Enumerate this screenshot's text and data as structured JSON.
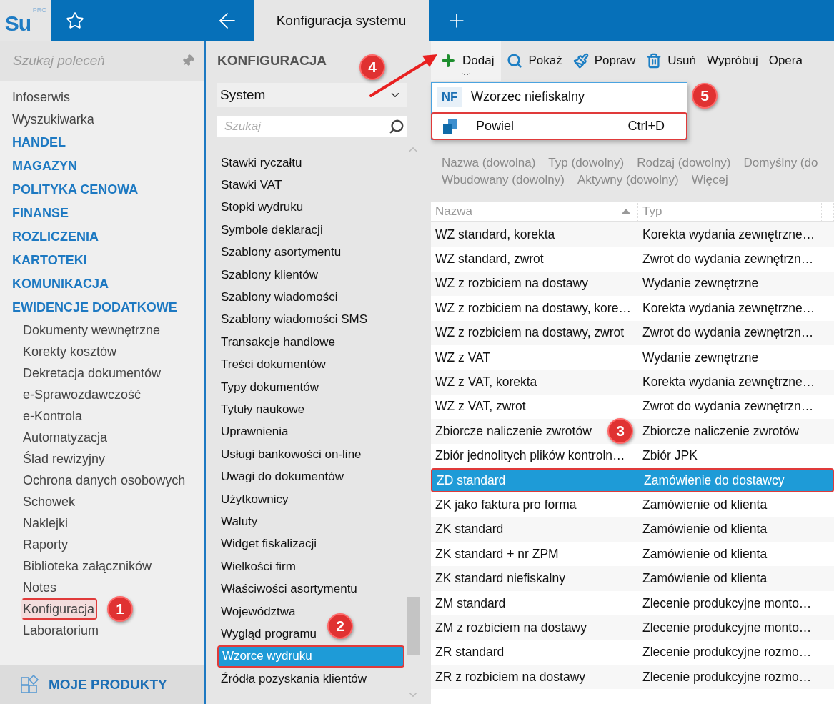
{
  "logo": {
    "text": "Su",
    "badge": "PRO"
  },
  "header": {
    "tab_title": "Konfiguracja systemu"
  },
  "sidebar": {
    "search": {
      "placeholder": "Szukaj poleceń"
    },
    "items": [
      {
        "label": "Infoserwis",
        "kind": "link",
        "highlighted": false
      },
      {
        "label": "Wyszukiwarka",
        "kind": "link",
        "highlighted": false
      },
      {
        "label": "HANDEL",
        "kind": "section",
        "highlighted": false
      },
      {
        "label": "MAGAZYN",
        "kind": "section",
        "highlighted": false
      },
      {
        "label": "POLITYKA CENOWA",
        "kind": "section",
        "highlighted": false
      },
      {
        "label": "FINANSE",
        "kind": "section",
        "highlighted": false
      },
      {
        "label": "ROZLICZENIA",
        "kind": "section",
        "highlighted": false
      },
      {
        "label": "KARTOTEKI",
        "kind": "section",
        "highlighted": false
      },
      {
        "label": "KOMUNIKACJA",
        "kind": "section",
        "highlighted": false
      },
      {
        "label": "EWIDENCJE DODATKOWE",
        "kind": "section",
        "highlighted": false
      },
      {
        "label": "Dokumenty wewnętrzne",
        "kind": "subitem",
        "highlighted": false
      },
      {
        "label": "Korekty kosztów",
        "kind": "subitem",
        "highlighted": false
      },
      {
        "label": "Dekretacja dokumentów",
        "kind": "subitem",
        "highlighted": false
      },
      {
        "label": "e-Sprawozdawczość",
        "kind": "subitem",
        "highlighted": false
      },
      {
        "label": "e-Kontrola",
        "kind": "subitem",
        "highlighted": false
      },
      {
        "label": "Automatyzacja",
        "kind": "subitem",
        "highlighted": false
      },
      {
        "label": "Ślad rewizyjny",
        "kind": "subitem",
        "highlighted": false
      },
      {
        "label": "Ochrona danych osobowych",
        "kind": "subitem",
        "highlighted": false
      },
      {
        "label": "Schowek",
        "kind": "subitem",
        "highlighted": false
      },
      {
        "label": "Naklejki",
        "kind": "subitem",
        "highlighted": false
      },
      {
        "label": "Raporty",
        "kind": "subitem",
        "highlighted": false
      },
      {
        "label": "Biblioteka załączników",
        "kind": "subitem",
        "highlighted": false
      },
      {
        "label": "Notes",
        "kind": "subitem",
        "highlighted": false
      },
      {
        "label": "Konfiguracja",
        "kind": "subitem",
        "highlighted": true
      },
      {
        "label": "Laboratorium",
        "kind": "subitem",
        "highlighted": false
      }
    ],
    "footer": "MOJE PRODUKTY"
  },
  "config_panel": {
    "title": "KONFIGURACJA",
    "select": {
      "value": "System"
    },
    "search": {
      "placeholder": "Szukaj"
    },
    "items": [
      {
        "label": "Stawki ryczałtu",
        "selected": false
      },
      {
        "label": "Stawki VAT",
        "selected": false
      },
      {
        "label": "Stopki wydruku",
        "selected": false
      },
      {
        "label": "Symbole deklaracji",
        "selected": false
      },
      {
        "label": "Szablony asortymentu",
        "selected": false
      },
      {
        "label": "Szablony klientów",
        "selected": false
      },
      {
        "label": "Szablony wiadomości",
        "selected": false
      },
      {
        "label": "Szablony wiadomości SMS",
        "selected": false
      },
      {
        "label": "Transakcje handlowe",
        "selected": false
      },
      {
        "label": "Treści dokumentów",
        "selected": false
      },
      {
        "label": "Typy dokumentów",
        "selected": false
      },
      {
        "label": "Tytuły naukowe",
        "selected": false
      },
      {
        "label": "Uprawnienia",
        "selected": false
      },
      {
        "label": "Usługi bankowości on-line",
        "selected": false
      },
      {
        "label": "Uwagi do dokumentów",
        "selected": false
      },
      {
        "label": "Użytkownicy",
        "selected": false
      },
      {
        "label": "Waluty",
        "selected": false
      },
      {
        "label": "Widget fiskalizacji",
        "selected": false
      },
      {
        "label": "Wielkości firm",
        "selected": false
      },
      {
        "label": "Właściwości asortymentu",
        "selected": false
      },
      {
        "label": "Województwa",
        "selected": false
      },
      {
        "label": "Wygląd programu",
        "selected": false
      },
      {
        "label": "Wzorce wydruku",
        "selected": true
      },
      {
        "label": "Źródła pozyskania klientów",
        "selected": false
      }
    ]
  },
  "toolbar": {
    "buttons": [
      {
        "label": "Dodaj",
        "kind": "add",
        "expanded": true
      },
      {
        "label": "Pokaż",
        "kind": "show",
        "expanded": false
      },
      {
        "label": "Popraw",
        "kind": "edit",
        "expanded": false
      },
      {
        "label": "Usuń",
        "kind": "delete",
        "expanded": false
      },
      {
        "label": "Wypróbuj",
        "kind": "text",
        "expanded": false
      },
      {
        "label": "Opera",
        "kind": "text",
        "expanded": false
      }
    ]
  },
  "menu": {
    "items": [
      {
        "label": "Wzorzec niefiskalny",
        "kind": "badge",
        "badge": "NF",
        "highlighted": false
      },
      {
        "label": "Powiel",
        "kind": "copy",
        "shortcut": "Ctrl+D",
        "highlighted": true
      }
    ]
  },
  "filter_rows": [
    {
      "items": [
        "Nazwa (dowolna)",
        "Typ (dowolny)",
        "Rodzaj (dowolny)",
        "Domyślny (do"
      ]
    },
    {
      "items": [
        "Wbudowany (dowolny)",
        "Aktywny (dowolny)",
        "Więcej"
      ]
    }
  ],
  "table": {
    "columns": [
      {
        "label": "Nazwa",
        "sorted": true
      },
      {
        "label": "Typ",
        "sorted": false
      }
    ],
    "rows": [
      {
        "cells": [
          "WZ standard, korekta",
          "Korekta wydania zewnętrzne…"
        ],
        "selected": false,
        "highlighted": false
      },
      {
        "cells": [
          "WZ standard, zwrot",
          "Zwrot do wydania zewnętrzn…"
        ],
        "selected": false,
        "highlighted": false
      },
      {
        "cells": [
          "WZ z rozbiciem na dostawy",
          "Wydanie zewnętrzne"
        ],
        "selected": false,
        "highlighted": false
      },
      {
        "cells": [
          "WZ z rozbiciem na dostawy, kore…",
          "Korekta wydania zewnętrzne…"
        ],
        "selected": false,
        "highlighted": false
      },
      {
        "cells": [
          "WZ z rozbiciem na dostawy, zwrot",
          "Zwrot do wydania zewnętrzn…"
        ],
        "selected": false,
        "highlighted": false
      },
      {
        "cells": [
          "WZ z VAT",
          "Wydanie zewnętrzne"
        ],
        "selected": false,
        "highlighted": false
      },
      {
        "cells": [
          "WZ z VAT, korekta",
          "Korekta wydania zewnętrzne…"
        ],
        "selected": false,
        "highlighted": false
      },
      {
        "cells": [
          "WZ z VAT, zwrot",
          "Zwrot do wydania zewnętrzn…"
        ],
        "selected": false,
        "highlighted": false
      },
      {
        "cells": [
          "Zbiorcze naliczenie zwrotów",
          "Zbiorcze naliczenie zwrotów"
        ],
        "selected": false,
        "highlighted": false
      },
      {
        "cells": [
          "Zbiór jednolitych plików kontroln…",
          "Zbiór JPK"
        ],
        "selected": false,
        "highlighted": false
      },
      {
        "cells": [
          "ZD standard",
          "Zamówienie do dostawcy"
        ],
        "selected": true,
        "highlighted": true
      },
      {
        "cells": [
          "ZK jako faktura pro forma",
          "Zamówienie od klienta"
        ],
        "selected": false,
        "highlighted": false
      },
      {
        "cells": [
          "ZK standard",
          "Zamówienie od klienta"
        ],
        "selected": false,
        "highlighted": false
      },
      {
        "cells": [
          "ZK standard + nr ZPM",
          "Zamówienie od klienta"
        ],
        "selected": false,
        "highlighted": false
      },
      {
        "cells": [
          "ZK standard niefiskalny",
          "Zamówienie od klienta"
        ],
        "selected": false,
        "highlighted": false
      },
      {
        "cells": [
          "ZM standard",
          "Zlecenie produkcyjne monto…"
        ],
        "selected": false,
        "highlighted": false
      },
      {
        "cells": [
          "ZM z rozbiciem na dostawy",
          "Zlecenie produkcyjne monto…"
        ],
        "selected": false,
        "highlighted": false
      },
      {
        "cells": [
          "ZR standard",
          "Zlecenie produkcyjne rozmo…"
        ],
        "selected": false,
        "highlighted": false
      },
      {
        "cells": [
          "ZR z rozbiciem na dostawy",
          "Zlecenie produkcyjne rozmo…"
        ],
        "selected": false,
        "highlighted": false
      }
    ]
  },
  "annotations": [
    {
      "label": "1",
      "kind": "badge"
    },
    {
      "label": "2",
      "kind": "badge"
    },
    {
      "label": "3",
      "kind": "badge"
    },
    {
      "label": "4",
      "kind": "badge-arrow"
    },
    {
      "label": "5",
      "kind": "badge"
    }
  ]
}
